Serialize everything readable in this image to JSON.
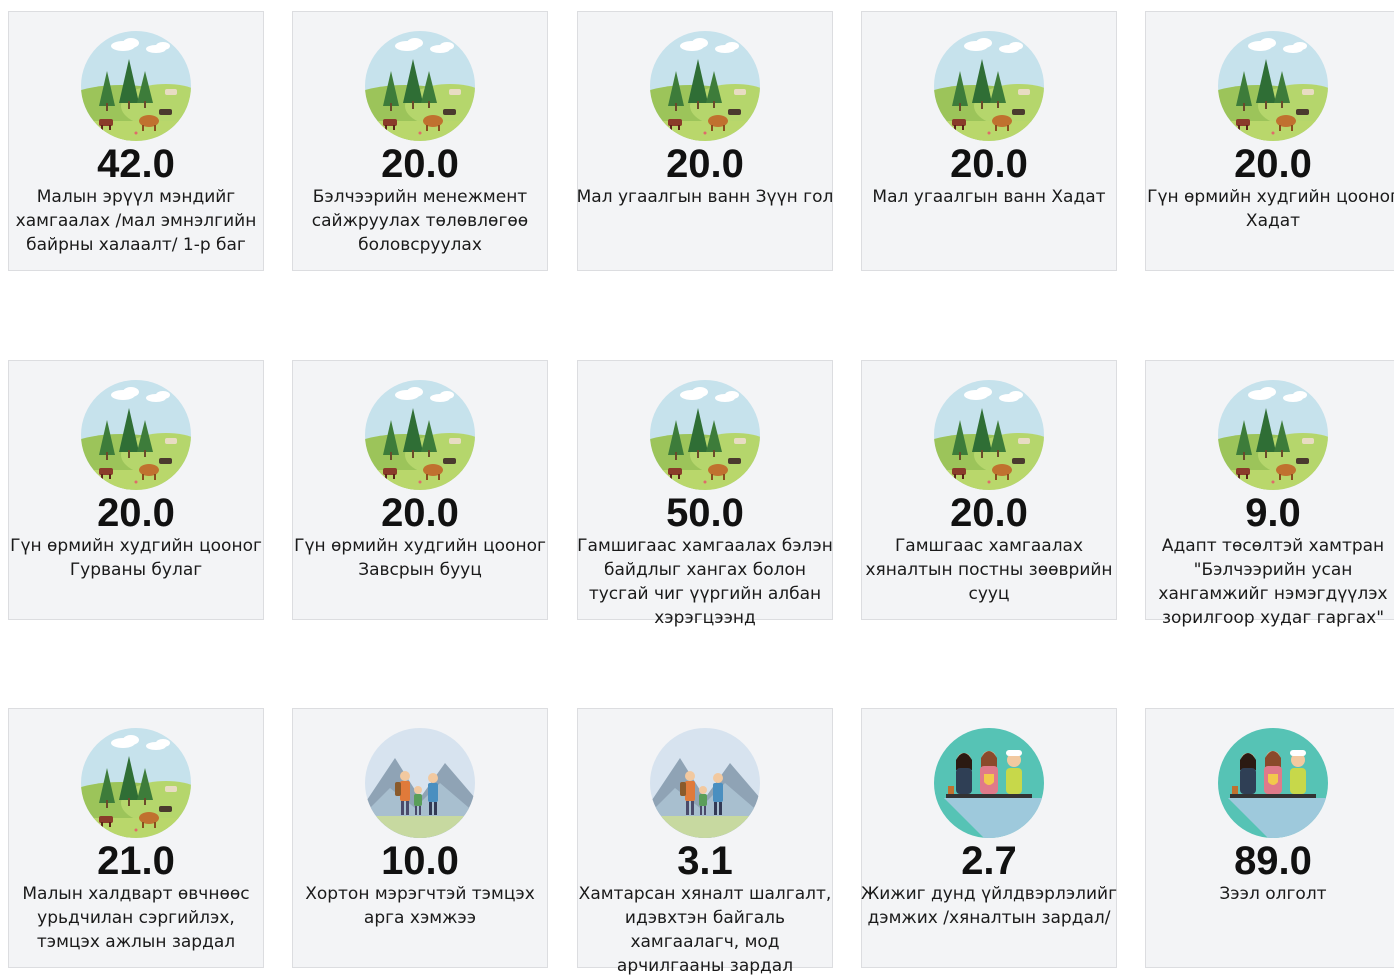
{
  "cards": [
    {
      "value": "42.0",
      "label": "Малын эрүүл мэндийг хамгаалах /мал эмнэлгийн байрны халаалт/ 1-р баг",
      "icon": "pasture-icon"
    },
    {
      "value": "20.0",
      "label": "Бэлчээрийн менежмент сайжруулах төлөвлөгөө боловсруулах",
      "icon": "pasture-icon"
    },
    {
      "value": "20.0",
      "label": "Мал угаалгын ванн Зүүн гол",
      "icon": "pasture-icon"
    },
    {
      "value": "20.0",
      "label": "Мал угаалгын ванн Хадат",
      "icon": "pasture-icon"
    },
    {
      "value": "20.0",
      "label": "Гүн өрмийн худгийн цооног Хадат",
      "icon": "pasture-icon"
    },
    {
      "value": "20.0",
      "label": "Гүн өрмийн худгийн цооног Гурваны булаг",
      "icon": "pasture-icon"
    },
    {
      "value": "20.0",
      "label": "Гүн өрмийн худгийн цооног Завсрын бууц",
      "icon": "pasture-icon"
    },
    {
      "value": "50.0",
      "label": "Гамшигаас хамгаалах бэлэн байдлыг хангах болон тусгай чиг үүргийн албан хэрэгцээнд",
      "icon": "pasture-icon"
    },
    {
      "value": "20.0",
      "label": "Гамшгаас хамгаалах хяналтын постны зөөврийн сууц",
      "icon": "pasture-icon"
    },
    {
      "value": "9.0",
      "label": "Адапт төсөлтэй хамтран \"Бэлчээрийн усан хангамжийг нэмэгдүүлэх зорилгоор худаг гаргах\"",
      "icon": "pasture-icon"
    },
    {
      "value": "21.0",
      "label": "Малын халдварт өвчнөөс урьдчилан сэргийлэх, тэмцэх ажлын зардал",
      "icon": "pasture-icon"
    },
    {
      "value": "10.0",
      "label": "Хортон мэрэгчтэй тэмцэх арга хэмжээ",
      "icon": "hikers-icon"
    },
    {
      "value": "3.1",
      "label": "Хамтарсан хяналт шалгалт, идэвхтэн байгаль хамгаалагч, мод арчилгааны зардал",
      "icon": "hikers-icon"
    },
    {
      "value": "2.7",
      "label": "Жижиг дунд үйлдвэрлэлийг дэмжих /хяналтын зардал/",
      "icon": "workers-icon"
    },
    {
      "value": "89.0",
      "label": "Зээл олголт",
      "icon": "workers-icon"
    }
  ]
}
